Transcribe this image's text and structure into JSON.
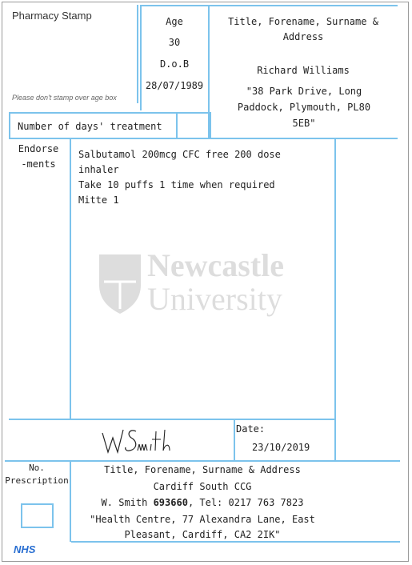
{
  "stamp": {
    "label": "Pharmacy Stamp",
    "note": "Please don't stamp over age box"
  },
  "patient": {
    "age_label": "Age",
    "age": "30",
    "dob_label": "D.o.B",
    "dob": "28/07/1989",
    "header": "Title, Forename, Surname & Address",
    "name": "Richard Williams",
    "address": "\"38 Park Drive, Long Paddock, Plymouth, PL80 5EB\""
  },
  "treatment": {
    "days_label": "Number of days' treatment",
    "days_value": ""
  },
  "endorsements": {
    "label_line1": "Endorse",
    "label_line2": "-ments"
  },
  "prescription": {
    "line1": "Salbutamol 200mcg CFC free 200 dose",
    "line2": "inhaler",
    "line3": "Take 10 puffs 1 time when required",
    "line4": "Mitte 1"
  },
  "watermark": {
    "line1": "Newcastle",
    "line2": "University"
  },
  "signature": {
    "text": "WSmith"
  },
  "date": {
    "label": "Date:",
    "value": "23/10/2019"
  },
  "prescriber": {
    "no_label_line1": "No.",
    "no_label_line2": "Prescription",
    "header": "Title, Forename, Surname & Address",
    "org": "Cardiff South CCG",
    "name_prefix": "W. Smith ",
    "number": "693660",
    "tel": ", Tel: 0217 763 7823",
    "address_line1": "\"Health Centre, 77 Alexandra Lane, East",
    "address_line2": "Pleasant, Cardiff, CA2 2IK\""
  },
  "footer": {
    "nhs": "NHS"
  }
}
